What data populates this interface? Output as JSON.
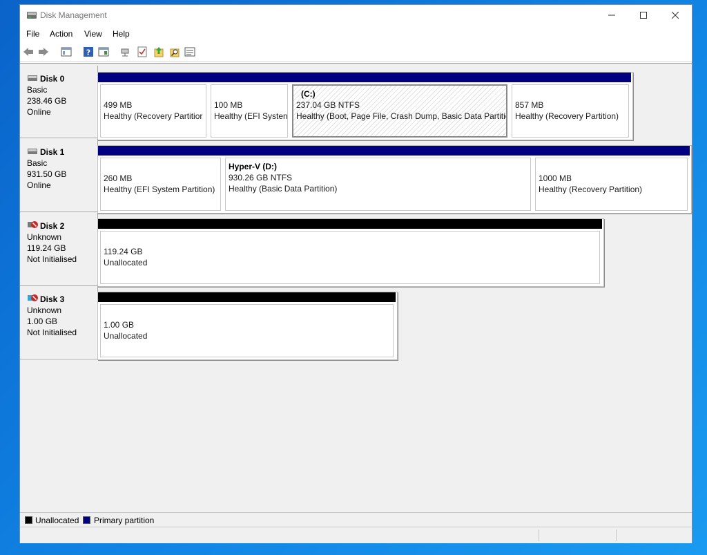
{
  "window": {
    "title": "Disk Management"
  },
  "menu": [
    "File",
    "Action",
    "View",
    "Help"
  ],
  "toolbar": {
    "icons": [
      "back-arrow-icon",
      "forward-arrow-icon",
      "console-tree-icon",
      "help-icon",
      "properties-icon",
      "connect-icon",
      "check-icon",
      "export-icon",
      "search-icon",
      "details-icon"
    ]
  },
  "disks": [
    {
      "name": "Disk 0",
      "type": "Basic",
      "size": "238.46 GB",
      "status": "Online",
      "partitions": [
        {
          "size": "499 MB",
          "status": "Healthy (Recovery Partitior"
        },
        {
          "size": "100 MB",
          "status": "Healthy (EFI Systen"
        },
        {
          "label": "(C:)",
          "size": "237.04 GB NTFS",
          "status": "Healthy (Boot, Page File, Crash Dump, Basic Data Partitio"
        },
        {
          "size": "857 MB",
          "status": "Healthy (Recovery Partition)"
        }
      ]
    },
    {
      "name": "Disk 1",
      "type": "Basic",
      "size": "931.50 GB",
      "status": "Online",
      "partitions": [
        {
          "size": "260 MB",
          "status": "Healthy (EFI System Partition)"
        },
        {
          "label": "Hyper-V  (D:)",
          "size": "930.26 GB NTFS",
          "status": "Healthy (Basic Data Partition)"
        },
        {
          "size": "1000 MB",
          "status": "Healthy (Recovery Partition)"
        }
      ]
    },
    {
      "name": "Disk 2",
      "type": "Unknown",
      "size": "119.24 GB",
      "status": "Not Initialised",
      "partitions": [
        {
          "size": "119.24 GB",
          "status": "Unallocated"
        }
      ]
    },
    {
      "name": "Disk 3",
      "type": "Unknown",
      "size": "1.00 GB",
      "status": "Not Initialised",
      "partitions": [
        {
          "size": "1.00 GB",
          "status": "Unallocated"
        }
      ]
    }
  ],
  "legend": [
    {
      "label": "Unallocated",
      "color": "#000000"
    },
    {
      "label": "Primary partition",
      "color": "#000080"
    }
  ],
  "colors": {
    "primary": "#000080",
    "unallocated": "#000000"
  }
}
